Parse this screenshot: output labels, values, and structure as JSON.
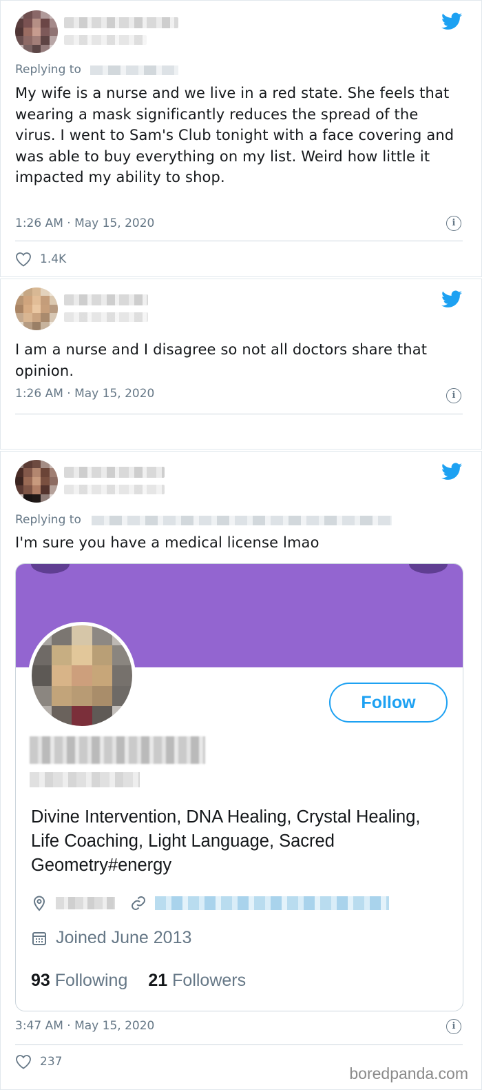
{
  "tweets": [
    {
      "replying_to_label": "Replying to",
      "text": "My wife is a nurse and we live in a red state. She feels that wearing a mask significantly reduces the spread of the virus. I went to Sam's Club tonight with a face covering and was able to buy everything on my list. Weird how little it impacted my ability to shop.",
      "timestamp": "1:26 AM · May 15, 2020",
      "likes": "1.4K"
    },
    {
      "text": "I am a nurse and I disagree so not all doctors share that opinion.",
      "timestamp": "1:26 AM · May 15, 2020"
    },
    {
      "replying_to_label": "Replying to",
      "text": "I'm sure you have a medical license lmao",
      "timestamp": "3:47 AM · May 15, 2020",
      "likes": "237",
      "profile_card": {
        "follow_label": "Follow",
        "bio": "Divine Intervention, DNA Healing, Crystal Healing, Life Coaching, Light Language, Sacred Geometry#energy",
        "joined": "Joined June 2013",
        "following_count": "93",
        "following_label": "Following",
        "followers_count": "21",
        "followers_label": "Followers",
        "banner_color": "#9365d0"
      }
    }
  ],
  "icons": {
    "brand": "twitter-bird-icon",
    "info": "info-icon",
    "like": "heart-icon",
    "location": "location-pin-icon",
    "link": "link-icon",
    "calendar": "calendar-icon"
  },
  "colors": {
    "twitter_blue": "#1da1f2",
    "muted_text": "#657786",
    "divider": "#ccd6dd"
  },
  "watermark": "boredpanda.com"
}
